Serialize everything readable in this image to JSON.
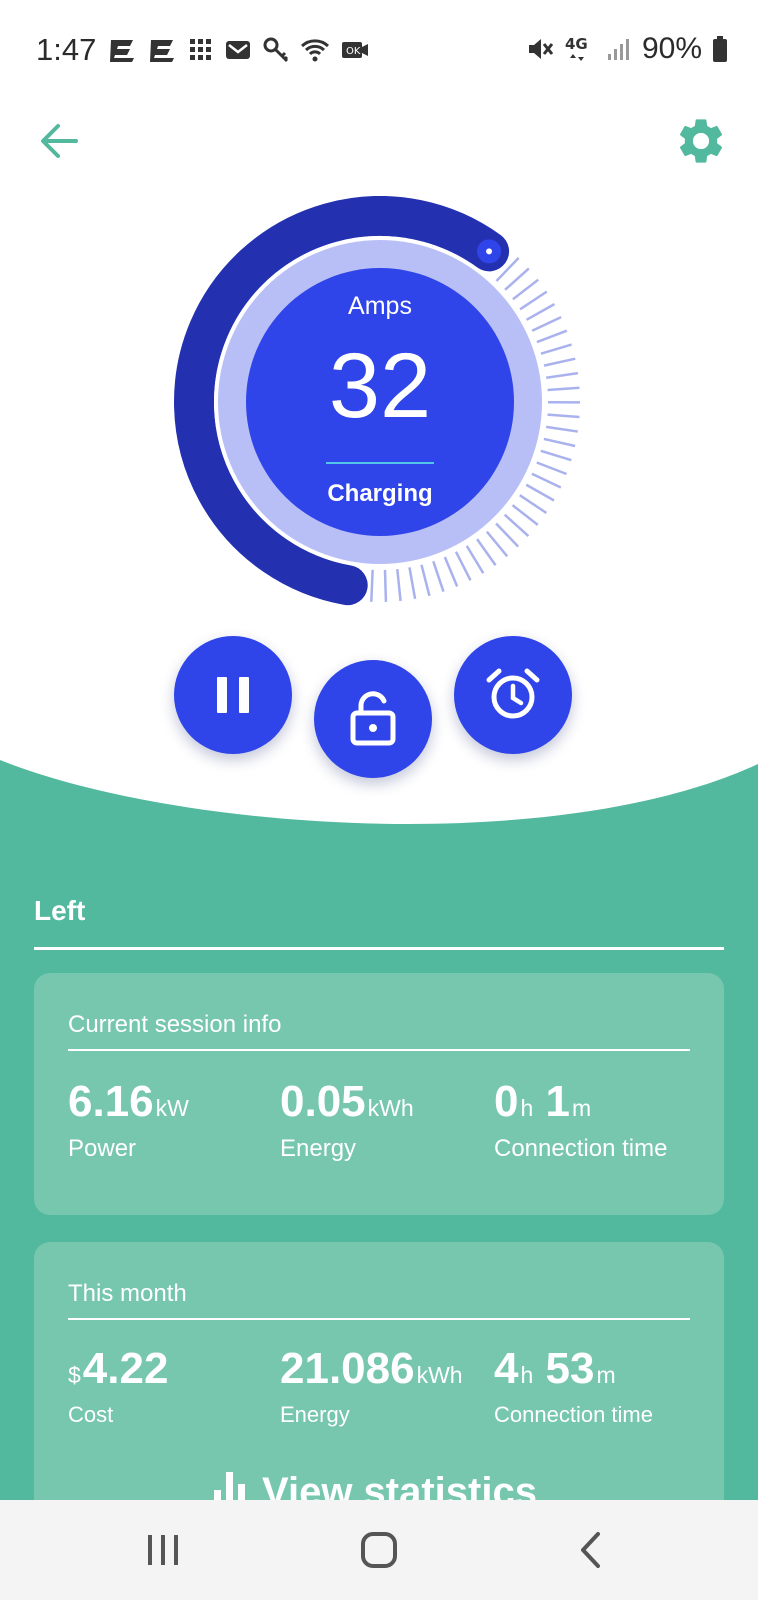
{
  "status_bar": {
    "time": "1:47",
    "battery_text": "90%",
    "network_label": "4G"
  },
  "toolbar": {
    "back_icon": "arrow-back-icon",
    "settings_icon": "gear-icon"
  },
  "charger": {
    "label": "Amps",
    "value": "32",
    "state": "Charging",
    "current_fraction": 0.58
  },
  "actions": [
    {
      "name": "pause",
      "icon": "pause-icon"
    },
    {
      "name": "unlock",
      "icon": "unlock-icon"
    },
    {
      "name": "schedule",
      "icon": "alarm-clock-icon"
    }
  ],
  "section": {
    "title": "Left"
  },
  "current_session": {
    "title": "Current session info",
    "power": {
      "value": "6.16",
      "unit": "kW",
      "label": "Power"
    },
    "energy": {
      "value": "0.05",
      "unit": "kWh",
      "label": "Energy"
    },
    "connection": {
      "hours": "0",
      "hours_unit": "h",
      "minutes": "1",
      "minutes_unit": "m",
      "label": "Connection time"
    }
  },
  "this_month": {
    "title": "This month",
    "cost": {
      "prefix": "$",
      "value": "4.22",
      "label": "Cost"
    },
    "energy": {
      "value": "21.086",
      "unit": "kWh",
      "label": "Energy"
    },
    "connection": {
      "hours": "4",
      "hours_unit": "h",
      "minutes": "53",
      "minutes_unit": "m",
      "label": "Connection time"
    }
  },
  "view_statistics": {
    "label": "View statistics"
  },
  "colors": {
    "accent_green": "#52b89e",
    "card_green": "#77c6ae",
    "dial_dark_blue": "#2330b0",
    "dial_light_blue": "#b8bff6",
    "button_blue": "#2f44e9"
  }
}
